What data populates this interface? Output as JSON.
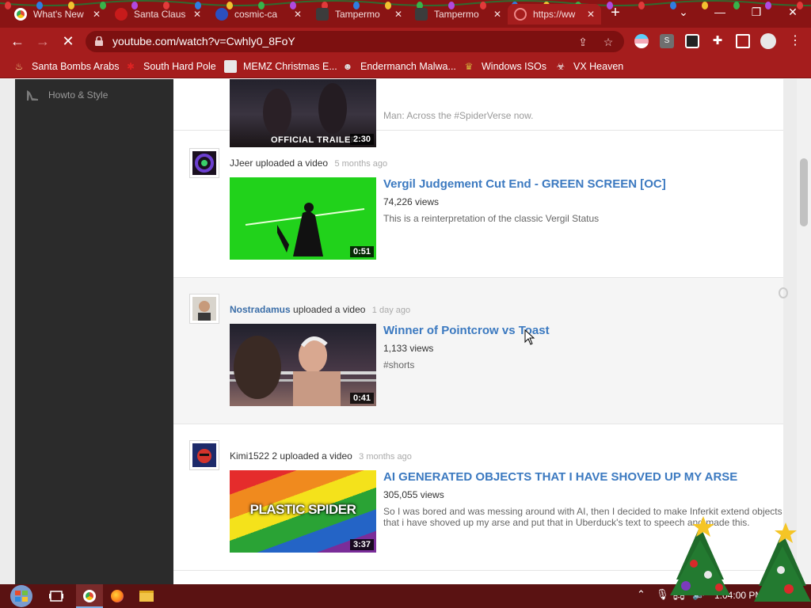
{
  "browser": {
    "tabs": [
      {
        "title": "What's New",
        "fav": "#e04b3a"
      },
      {
        "title": "Santa Claus",
        "fav": "#c71b1b"
      },
      {
        "title": "cosmic-ca",
        "fav": "#2b4fc0"
      },
      {
        "title": "Tampermo",
        "fav": "#3c3c3c"
      },
      {
        "title": "Tampermo",
        "fav": "#3c3c3c"
      },
      {
        "title": "https://ww",
        "fav": "#a51d1d"
      }
    ],
    "newtab_label": "+",
    "window": {
      "minimize": "—",
      "maximize": "❐",
      "close": "✕",
      "tablist": "⌄"
    },
    "url": "youtube.com/watch?v=Cwhly0_8FoY",
    "back": "←",
    "forward": "→",
    "reload": "✕"
  },
  "bookmarks": [
    {
      "label": "Santa Bombs Arabs",
      "icon": "candle-icon"
    },
    {
      "label": "South Hard Pole",
      "icon": "snowflake-icon"
    },
    {
      "label": "MEMZ Christmas E...",
      "icon": "memz-icon"
    },
    {
      "label": "Endermanch Malwa...",
      "icon": "wolf-icon"
    },
    {
      "label": "Windows ISOs",
      "icon": "trophy-icon"
    },
    {
      "label": "VX Heaven",
      "icon": "biohazard-icon"
    }
  ],
  "sidebar": {
    "items": [
      {
        "label": "Howto & Style",
        "icon": "heel-icon"
      }
    ]
  },
  "feed": [
    {
      "partial": true,
      "uploader": "",
      "action": "",
      "ago": "",
      "title": "",
      "views": "",
      "desc": "Man: Across the #SpiderVerse now.",
      "duration": "2:30",
      "thumb_caption": "OFFICIAL TRAILER"
    },
    {
      "uploader": "JJeer",
      "action": "uploaded a video",
      "ago": "5 months ago",
      "title": "Vergil Judgement Cut End - GREEN SCREEN [OC]",
      "views": "74,226 views",
      "desc": "This is a reinterpretation of the classic Vergil Status",
      "duration": "0:51"
    },
    {
      "uploader": "Nostradamus",
      "action": "uploaded a video",
      "ago": "1 day ago",
      "title": "Winner of Pointcrow vs Toast",
      "views": "1,133 views",
      "desc": "#shorts",
      "duration": "0:41"
    },
    {
      "uploader": "Kimi1522 2",
      "action": "uploaded a video",
      "ago": "3 months ago",
      "title": "AI GENERATED OBJECTS THAT I HAVE SHOVED UP MY ARSE",
      "views": "305,055 views",
      "desc": "So I was bored and was messing around with AI, then I decided to make Inferkit extend objects that i have shoved up my arse and put that in Uberduck's text to speech and made this.",
      "duration": "3:37",
      "thumb_caption": "PLASTIC SPIDER"
    }
  ],
  "taskbar": {
    "clock": "1:04:00 PM"
  },
  "colors": {
    "chrome": "#a51d1d",
    "tabstrip": "#8a1414",
    "link": "#3b79c0",
    "sidebar": "#2b2b2b"
  }
}
